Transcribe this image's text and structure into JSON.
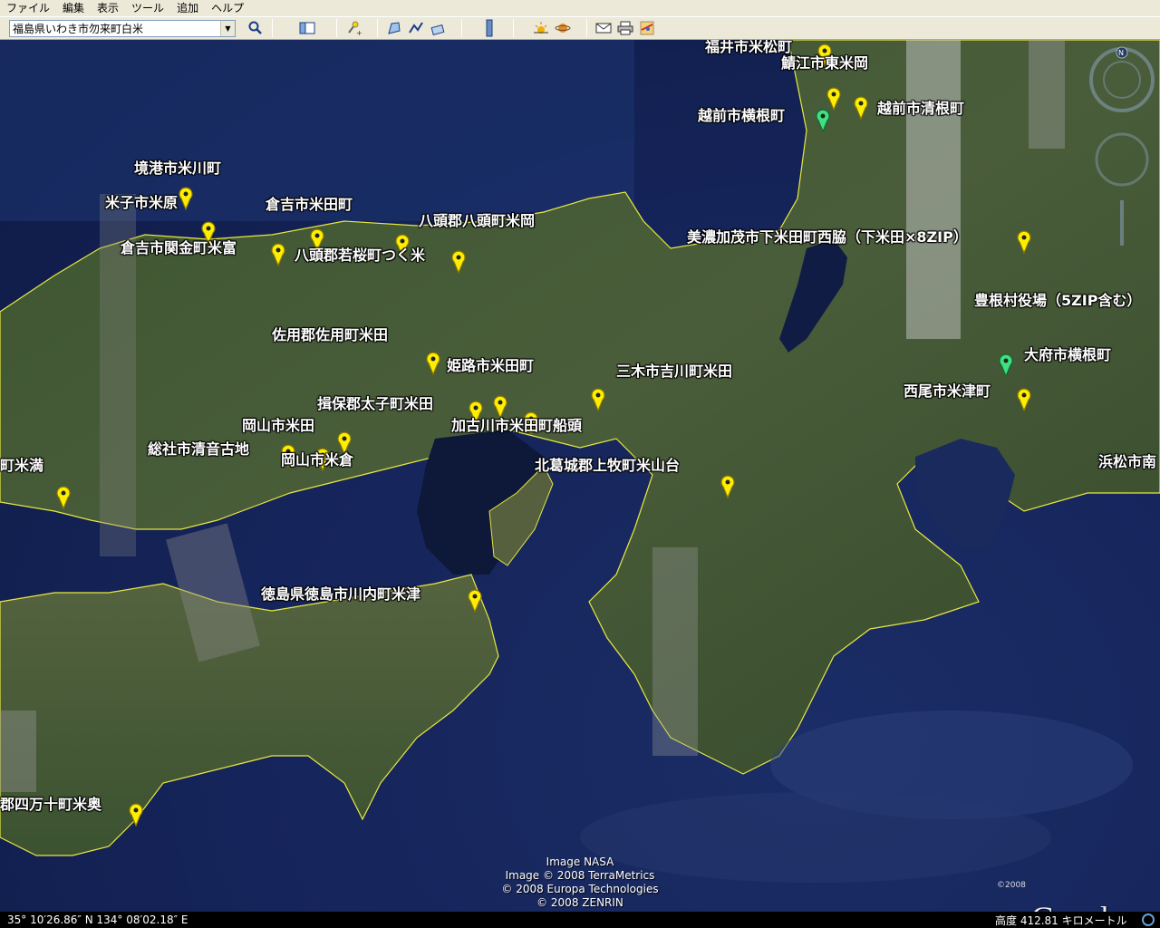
{
  "menu": [
    "ファイル",
    "編集",
    "表示",
    "ツール",
    "追加",
    "ヘルプ"
  ],
  "search": {
    "value": "福島県いわき市勿来町白米"
  },
  "toolbar_icons": [
    "search-icon",
    "sidebar-icon",
    "placemark-add-icon",
    "polygon-icon",
    "path-icon",
    "overlay-icon",
    "ruler-icon",
    "sun-icon",
    "planet-icon",
    "email-icon",
    "print-icon",
    "maps-icon"
  ],
  "placemarks": [
    {
      "label": "福井市米松町",
      "color": "yellow"
    },
    {
      "label": "鯖江市東米岡",
      "color": "yellow"
    },
    {
      "label": "越前市横根町",
      "color": "green"
    },
    {
      "label": "越前市清根町",
      "color": "yellow"
    },
    {
      "label": "境港市米川町",
      "color": "yellow"
    },
    {
      "label": "米子市米原",
      "color": "yellow"
    },
    {
      "label": "倉吉市米田町",
      "color": "yellow"
    },
    {
      "label": "倉吉市関金町米富",
      "color": "yellow"
    },
    {
      "label": "八頭郡八頭町米岡",
      "color": "yellow"
    },
    {
      "label": "八頭郡若桜町つく米",
      "color": "yellow"
    },
    {
      "label": "美濃加茂市下米田町西脇（下米田×8ZIP）",
      "color": "yellow"
    },
    {
      "label": "豊根村役場（5ZIP含む）",
      "color": "yellow"
    },
    {
      "label": "大府市横根町",
      "color": "green"
    },
    {
      "label": "西尾市米津町",
      "color": "yellow"
    },
    {
      "label": "佐用郡佐用町米田",
      "color": "yellow"
    },
    {
      "label": "姫路市米田町",
      "color": "yellow"
    },
    {
      "label": "三木市吉川町米田",
      "color": "yellow"
    },
    {
      "label": "揖保郡太子町米田",
      "color": "yellow"
    },
    {
      "label": "加古川市米田町船頭",
      "color": "yellow"
    },
    {
      "label": "岡山市米田",
      "color": "yellow"
    },
    {
      "label": "総社市清音古地",
      "color": "yellow"
    },
    {
      "label": "岡山市米倉",
      "color": "yellow"
    },
    {
      "label": "町米満",
      "color": "yellow"
    },
    {
      "label": "北葛城郡上牧町米山台",
      "color": "yellow"
    },
    {
      "label": "浜松市南",
      "color": "yellow"
    },
    {
      "label": "徳島県徳島市川内町米津",
      "color": "yellow"
    },
    {
      "label": "郡四万十町米奥",
      "color": "yellow"
    }
  ],
  "credits": [
    "Image NASA",
    "Image © 2008 TerraMetrics",
    "© 2008 Europa Technologies",
    "© 2008 ZENRIN"
  ],
  "logo": "Google",
  "logo_year": "©2008",
  "status": {
    "coords": "35° 10′26.86″ N  134° 08′02.18″ E",
    "altitude": "高度   412.81 キロメートル"
  }
}
